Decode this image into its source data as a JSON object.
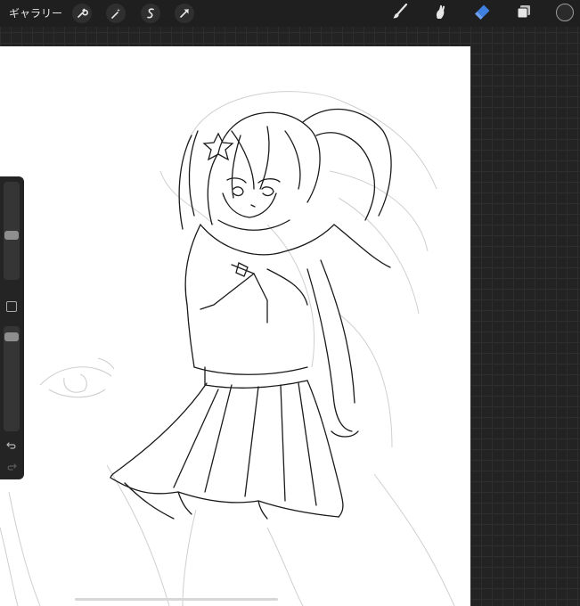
{
  "toolbar": {
    "gallery_label": "ギャラリー",
    "left_icons": [
      "wrench-icon",
      "magic-wand-icon",
      "selection-icon",
      "transform-arrow-icon"
    ],
    "right_icons": [
      "brush-icon",
      "smudge-icon",
      "eraser-icon",
      "layers-icon",
      "color-icon"
    ]
  },
  "colors": {
    "background": "#232323",
    "toolbar_bg": "#1f1f1f",
    "active_tool": "#3f7fe0",
    "canvas": "#ffffff"
  },
  "active_tool": "eraser",
  "sidebar": {
    "brush_size_level": 0.45,
    "opacity_level": 0.95,
    "icons": [
      "modify-square-icon",
      "undo-icon",
      "redo-icon"
    ]
  }
}
